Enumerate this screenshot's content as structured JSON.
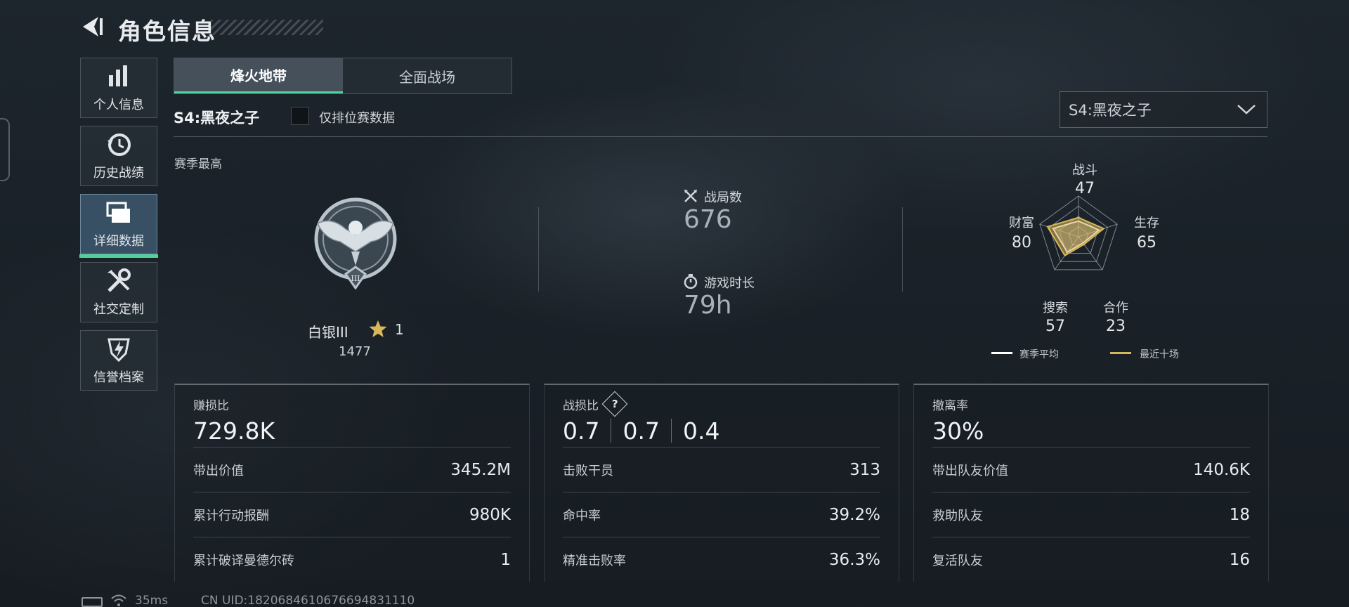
{
  "header": {
    "title": "角色信息",
    "back_icon": "back-arrow-icon"
  },
  "sidebar": {
    "items": [
      {
        "label": "个人信息",
        "icon": "bar-chart-icon",
        "active": false
      },
      {
        "label": "历史战绩",
        "icon": "history-clock-icon",
        "active": false
      },
      {
        "label": "详细数据",
        "icon": "folder-stack-icon",
        "active": true
      },
      {
        "label": "社交定制",
        "icon": "tools-icon",
        "active": false
      },
      {
        "label": "信誉档案",
        "icon": "shield-bolt-icon",
        "active": false
      }
    ]
  },
  "tabs": [
    {
      "label": "烽火地带",
      "active": true
    },
    {
      "label": "全面战场",
      "active": false
    }
  ],
  "filter": {
    "season_label": "S4:黑夜之子",
    "ranked_only_label": "仅排位赛数据",
    "ranked_only_checked": false,
    "season_select_value": "S4:黑夜之子"
  },
  "season_best": {
    "heading": "赛季最高",
    "rank_name": "白银III",
    "rank_stars": "1",
    "rank_score": "1477",
    "rank_emblem_numeral": "III"
  },
  "summary": {
    "matches_label": "战局数",
    "matches_value": "676",
    "playtime_label": "游戏时长",
    "playtime_value": "79h"
  },
  "radar": {
    "axes": [
      {
        "label": "战斗",
        "value": "47"
      },
      {
        "label": "生存",
        "value": "65"
      },
      {
        "label": "合作",
        "value": "23"
      },
      {
        "label": "搜索",
        "value": "57"
      },
      {
        "label": "财富",
        "value": "80"
      }
    ],
    "legend": [
      {
        "label": "赛季平均",
        "color": "#ffffff"
      },
      {
        "label": "最近十场",
        "color": "#d8b65a"
      }
    ]
  },
  "cards": [
    {
      "title": "赚损比",
      "big": [
        "729.8K"
      ],
      "rows": [
        {
          "k": "带出价值",
          "v": "345.2M"
        },
        {
          "k": "累计行动报酬",
          "v": "980K"
        },
        {
          "k": "累计破译曼德尔砖",
          "v": "1"
        }
      ]
    },
    {
      "title": "战损比",
      "help": "?",
      "big": [
        "0.7",
        "0.7",
        "0.4"
      ],
      "rows": [
        {
          "k": "击败干员",
          "v": "313"
        },
        {
          "k": "命中率",
          "v": "39.2%"
        },
        {
          "k": "精准击败率",
          "v": "36.3%"
        }
      ]
    },
    {
      "title": "撤离率",
      "big": [
        "30%"
      ],
      "rows": [
        {
          "k": "带出队友价值",
          "v": "140.6K"
        },
        {
          "k": "救助队友",
          "v": "18"
        },
        {
          "k": "复活队友",
          "v": "16"
        }
      ]
    }
  ],
  "footer": {
    "ping": "35ms",
    "uid": "CN UID:1820684610676694831110"
  },
  "colors": {
    "accent": "#4fd39a",
    "gold": "#d8b65a"
  }
}
